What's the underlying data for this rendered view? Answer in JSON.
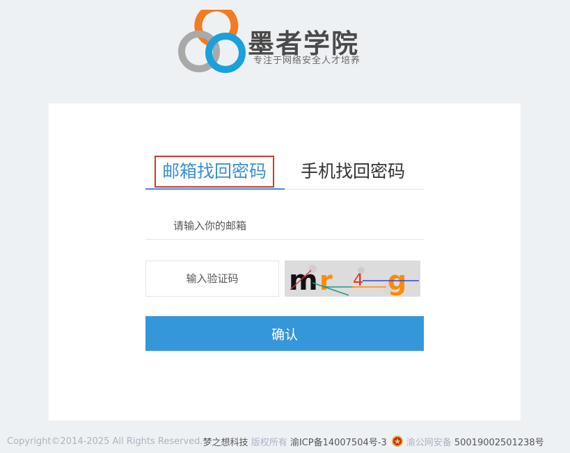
{
  "brand": {
    "title": "墨者学院",
    "slogan": "专注于网络安全人才培养",
    "colors": {
      "orange": "#f47b20",
      "blue": "#1aa0dc",
      "gray": "#a9a9a9"
    }
  },
  "tabs": {
    "email": {
      "label": "邮箱找回密码",
      "active": true
    },
    "phone": {
      "label": "手机找回密码",
      "active": false
    }
  },
  "form": {
    "email_placeholder": "请输入你的邮箱",
    "captcha_placeholder": "输入验证码",
    "captcha_text": "mr4g",
    "confirm_label": "确认"
  },
  "footer": {
    "copyright": "Copyright©2014-2025 All Rights Reserved.",
    "company": "梦之想科技",
    "rights": " 版权所有 ",
    "icp": "渝ICP备14007504号-3",
    "police_label": "渝公网安备",
    "police_number": " 50019002501238号"
  },
  "colors": {
    "accent": "#3497d9",
    "highlight_border": "#d33535",
    "background": "#eef1f4"
  }
}
